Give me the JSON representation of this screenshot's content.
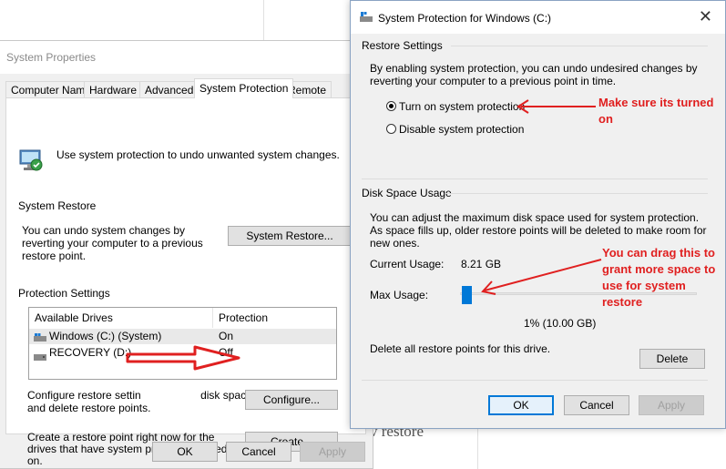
{
  "background": {
    "partial_text": "v restore"
  },
  "system_properties": {
    "title": "System Properties",
    "tabs": [
      {
        "label": "Computer Name"
      },
      {
        "label": "Hardware"
      },
      {
        "label": "Advanced"
      },
      {
        "label": "System Protection"
      },
      {
        "label": "Remote"
      }
    ],
    "intro_text": "Use system protection to undo unwanted system changes.",
    "system_restore": {
      "heading": "System Restore",
      "description": "You can undo system changes by reverting your computer to a previous restore point.",
      "button": "System Restore..."
    },
    "protection_settings": {
      "heading": "Protection Settings",
      "columns": [
        "Available Drives",
        "Protection"
      ],
      "rows": [
        {
          "drive": "Windows (C:) (System)",
          "protection": "On"
        },
        {
          "drive": "RECOVERY (D:)",
          "protection": "Off"
        }
      ],
      "configure_text_visible": "Configure restore settin",
      "configure_text_tail": "disk space,",
      "configure_text_line2": "and delete restore points.",
      "configure_button": "Configure...",
      "create_text": "Create a restore point right now for the drives that have system protection turned on.",
      "create_button": "Create..."
    },
    "ok": "OK",
    "cancel": "Cancel",
    "apply": "Apply"
  },
  "dialog": {
    "title": "System Protection for Windows (C:)",
    "close": "✕",
    "restore_settings": {
      "heading": "Restore Settings",
      "description": "By enabling system protection, you can undo undesired changes by reverting your computer to a previous point in time.",
      "option_on": "Turn on system protection",
      "option_off": "Disable system protection",
      "selected": "on"
    },
    "disk_space": {
      "heading": "Disk Space Usage",
      "description": "You can adjust the maximum disk space used for system protection. As space fills up, older restore points will be deleted to make room for new ones.",
      "current_label": "Current Usage:",
      "current_value": "8.21 GB",
      "max_label": "Max Usage:",
      "max_value": "1% (10.00 GB)",
      "slider_fraction": 0.01,
      "delete_text": "Delete all restore points for this drive.",
      "delete_button": "Delete"
    },
    "ok": "OK",
    "cancel": "Cancel",
    "apply": "Apply"
  },
  "annotations": {
    "note1": "Make sure its turned on",
    "note2": "You can drag this to grant more space to use for system restore",
    "color": "#e02020"
  },
  "colors": {
    "accent": "#0078d7",
    "annotation": "#e02020"
  }
}
